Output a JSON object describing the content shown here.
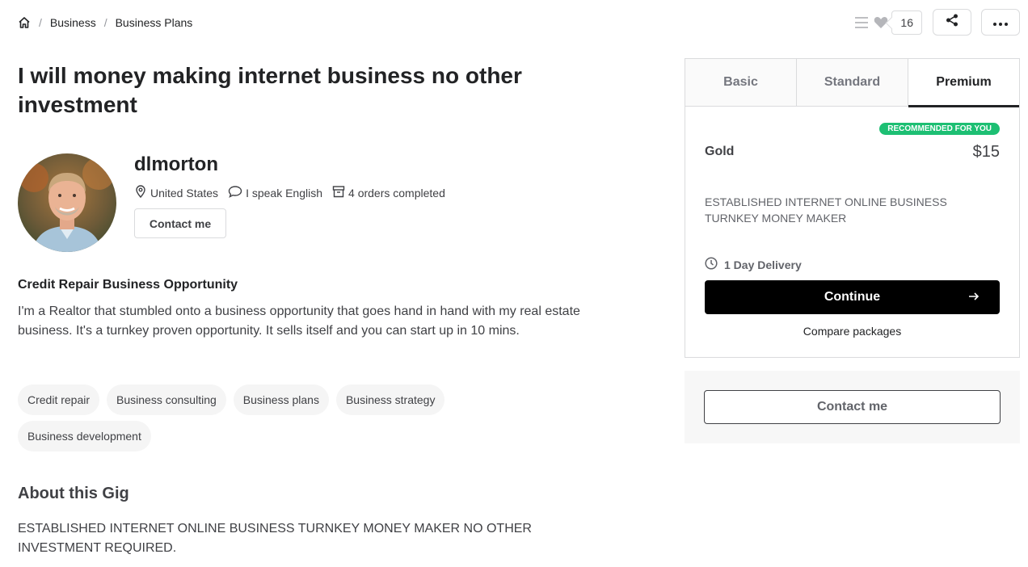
{
  "breadcrumb": {
    "home_icon": "home-icon",
    "items": [
      "Business",
      "Business Plans"
    ],
    "separator": "/"
  },
  "actions": {
    "collect_icon": "list-icon",
    "like_icon": "heart-icon",
    "like_count": "16",
    "share_icon": "share-icon",
    "more_icon": "more-dots-icon"
  },
  "gig": {
    "title": "I will money making internet business no other investment"
  },
  "seller": {
    "name": "dlmorton",
    "country": "United States",
    "language": "I speak English",
    "orders": "4 orders completed",
    "contact_label": "Contact me"
  },
  "description": {
    "heading": "Credit Repair Business Opportunity",
    "text": "I'm a Realtor that stumbled onto a business opportunity that goes hand in hand with my real estate business. It's a turnkey proven opportunity. It sells itself and you can start up in 10 mins."
  },
  "tags": [
    "Credit repair",
    "Business consulting",
    "Business plans",
    "Business strategy",
    "Business development"
  ],
  "about": {
    "heading": "About this Gig",
    "text": "ESTABLISHED INTERNET ONLINE BUSINESS TURNKEY MONEY MAKER NO OTHER INVESTMENT REQUIRED."
  },
  "package": {
    "tabs": [
      "Basic",
      "Standard",
      "Premium"
    ],
    "active_tab": "Premium",
    "badge": "RECOMMENDED FOR YOU",
    "name": "Gold",
    "price": "$15",
    "description": "ESTABLISHED INTERNET ONLINE BUSINESS TURNKEY MONEY MAKER",
    "delivery": "1 Day Delivery",
    "continue_label": "Continue",
    "compare_label": "Compare packages"
  },
  "contact_panel": {
    "button_label": "Contact me"
  },
  "colors": {
    "accent_green": "#1dbf73",
    "primary_button": "#000000",
    "text_dark": "#222325",
    "text_body": "#404145"
  }
}
